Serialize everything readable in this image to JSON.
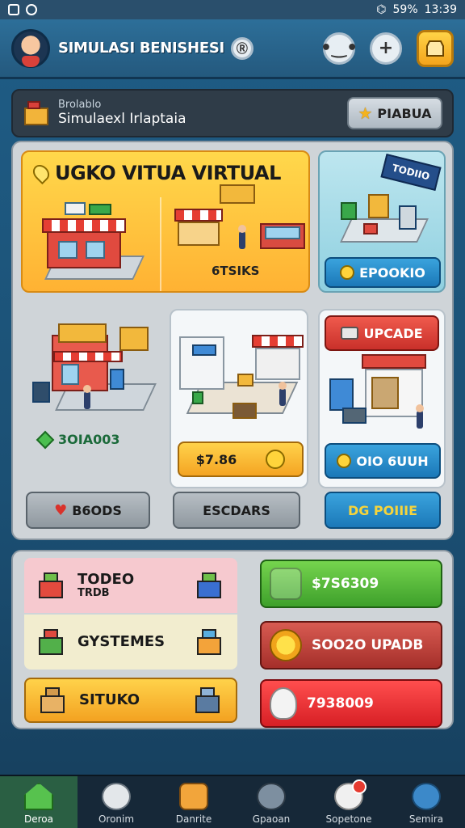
{
  "status": {
    "battery": "59%",
    "time": "13:39"
  },
  "app": {
    "title": "SIMULASI BENISHESI",
    "title_badge": "Ⓡ"
  },
  "info": {
    "small": "Brolablo",
    "main": "Simulaexl Irlaptaia",
    "button": "PIABUA"
  },
  "hero": {
    "title": "UGKO VITUA VIRTUAL",
    "sub": "6TSIKS"
  },
  "top_right": {
    "tag": "TODIIO",
    "button": "EPOOKIO"
  },
  "mid_left": {
    "value": "3OIA003",
    "button": "B6ODS"
  },
  "mid_mid": {
    "price": "$7.86",
    "button": "ESCDARS"
  },
  "mid_right": {
    "upgrade": "UPCADE",
    "button": "OIO 6UUH"
  },
  "action_far_right": {
    "label": "DG POIIIE"
  },
  "list": [
    {
      "label": "TODEO",
      "sub": "TRDB"
    },
    {
      "label": "GYSTEMES"
    },
    {
      "label": "SITUKO"
    }
  ],
  "stats": [
    {
      "label": "$7S6309",
      "color": "#3ea02b"
    },
    {
      "label": "SOO2O UPADB",
      "color": "#a52f2a"
    },
    {
      "label": "7938009",
      "color": "#d71f25"
    }
  ],
  "nav": [
    {
      "label": "Deroa",
      "icon": "home-icon"
    },
    {
      "label": "Oronim",
      "icon": "face-icon"
    },
    {
      "label": "Danrite",
      "icon": "box-icon"
    },
    {
      "label": "Gpaoan",
      "icon": "gear-icon"
    },
    {
      "label": "Sopetone",
      "icon": "ball-icon"
    },
    {
      "label": "Semira",
      "icon": "sun-icon"
    }
  ]
}
